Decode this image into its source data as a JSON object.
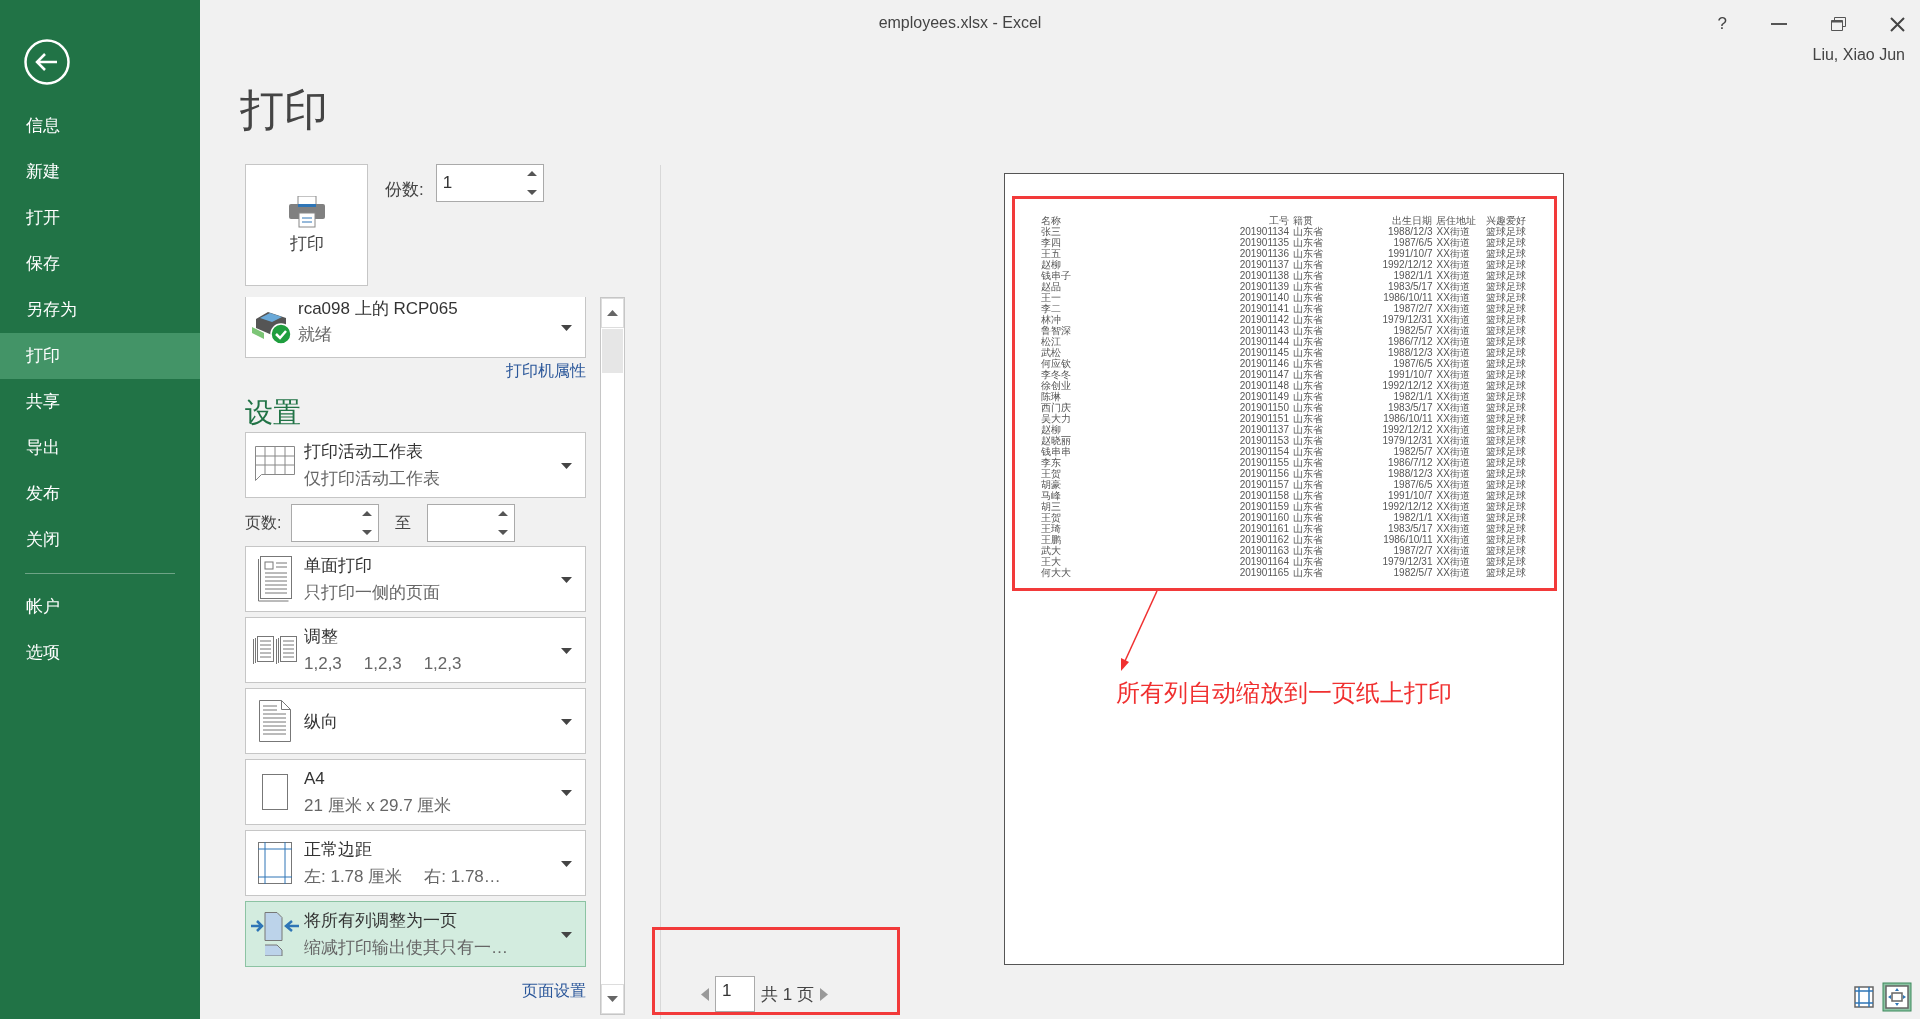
{
  "window": {
    "title": "employees.xlsx - Excel",
    "help": "?",
    "user": "Liu, Xiao Jun"
  },
  "nav": {
    "items": [
      {
        "label": "信息",
        "selected": false
      },
      {
        "label": "新建",
        "selected": false
      },
      {
        "label": "打开",
        "selected": false
      },
      {
        "label": "保存",
        "selected": false
      },
      {
        "label": "另存为",
        "selected": false
      },
      {
        "label": "打印",
        "selected": true
      },
      {
        "label": "共享",
        "selected": false
      },
      {
        "label": "导出",
        "selected": false
      },
      {
        "label": "发布",
        "selected": false
      },
      {
        "label": "关闭",
        "selected": false
      }
    ],
    "bottom_items": [
      {
        "label": "帐户",
        "selected": false
      },
      {
        "label": "选项",
        "selected": false
      }
    ]
  },
  "page_title": "打印",
  "print_button": {
    "label": "打印"
  },
  "copies": {
    "label": "份数:",
    "value": "1"
  },
  "printer": {
    "name": "rca098 上的 RCP065",
    "status": "就绪",
    "properties_link": "打印机属性"
  },
  "settings_title": "设置",
  "settings": [
    {
      "kind": "sheets",
      "title": "打印活动工作表",
      "subtitle": [
        "仅打印活动工作表"
      ],
      "selected": false
    },
    {
      "kind": "pages",
      "label": "页数:",
      "to_label": "至"
    },
    {
      "kind": "sides",
      "title": "单面打印",
      "subtitle": [
        "只打印一侧的页面"
      ],
      "selected": false
    },
    {
      "kind": "collate",
      "title": "调整",
      "subtitle": [
        "1,2,3",
        "1,2,3",
        "1,2,3"
      ],
      "selected": false
    },
    {
      "kind": "orientation",
      "title": "纵向",
      "selected": false
    },
    {
      "kind": "paper",
      "title": "A4",
      "subtitle": [
        "21 厘米 x 29.7 厘米"
      ],
      "selected": false
    },
    {
      "kind": "margins",
      "title": "正常边距",
      "subtitle": [
        "左: 1.78 厘米",
        "右: 1.78…"
      ],
      "selected": false
    },
    {
      "kind": "scaling",
      "title": "将所有列调整为一页",
      "subtitle": [
        "缩减打印输出使其只有一…"
      ],
      "selected": true
    }
  ],
  "page_setup_link": "页面设置",
  "preview": {
    "table": {
      "columns": [
        "名称",
        "工号",
        "籍贯",
        "出生日期",
        "居住地址",
        "兴趣爱好"
      ],
      "rows": [
        [
          "张三",
          "201901134",
          "山东省",
          "1988/12/3",
          "XX街道",
          "篮球足球"
        ],
        [
          "李四",
          "201901135",
          "山东省",
          "1987/6/5",
          "XX街道",
          "篮球足球"
        ],
        [
          "王五",
          "201901136",
          "山东省",
          "1991/10/7",
          "XX街道",
          "篮球足球"
        ],
        [
          "赵柳",
          "201901137",
          "山东省",
          "1992/12/12",
          "XX街道",
          "篮球足球"
        ],
        [
          "钱串子",
          "201901138",
          "山东省",
          "1982/1/1",
          "XX街道",
          "篮球足球"
        ],
        [
          "赵品",
          "201901139",
          "山东省",
          "1983/5/17",
          "XX街道",
          "篮球足球"
        ],
        [
          "王一",
          "201901140",
          "山东省",
          "1986/10/11",
          "XX街道",
          "篮球足球"
        ],
        [
          "李二",
          "201901141",
          "山东省",
          "1987/2/7",
          "XX街道",
          "篮球足球"
        ],
        [
          "林冲",
          "201901142",
          "山东省",
          "1979/12/31",
          "XX街道",
          "篮球足球"
        ],
        [
          "鲁智深",
          "201901143",
          "山东省",
          "1982/5/7",
          "XX街道",
          "篮球足球"
        ],
        [
          "松江",
          "201901144",
          "山东省",
          "1986/7/12",
          "XX街道",
          "篮球足球"
        ],
        [
          "武松",
          "201901145",
          "山东省",
          "1988/12/3",
          "XX街道",
          "篮球足球"
        ],
        [
          "何应钦",
          "201901146",
          "山东省",
          "1987/6/5",
          "XX街道",
          "篮球足球"
        ],
        [
          "李冬冬",
          "201901147",
          "山东省",
          "1991/10/7",
          "XX街道",
          "篮球足球"
        ],
        [
          "徐创业",
          "201901148",
          "山东省",
          "1992/12/12",
          "XX街道",
          "篮球足球"
        ],
        [
          "陈琳",
          "201901149",
          "山东省",
          "1982/1/1",
          "XX街道",
          "篮球足球"
        ],
        [
          "西门庆",
          "201901150",
          "山东省",
          "1983/5/17",
          "XX街道",
          "篮球足球"
        ],
        [
          "吴大力",
          "201901151",
          "山东省",
          "1986/10/11",
          "XX街道",
          "篮球足球"
        ],
        [
          "赵柳",
          "201901137",
          "山东省",
          "1992/12/12",
          "XX街道",
          "篮球足球"
        ],
        [
          "赵晓丽",
          "201901153",
          "山东省",
          "1979/12/31",
          "XX街道",
          "篮球足球"
        ],
        [
          "钱串串",
          "201901154",
          "山东省",
          "1982/5/7",
          "XX街道",
          "篮球足球"
        ],
        [
          "李东",
          "201901155",
          "山东省",
          "1986/7/12",
          "XX街道",
          "篮球足球"
        ],
        [
          "王贺",
          "201901156",
          "山东省",
          "1988/12/3",
          "XX街道",
          "篮球足球"
        ],
        [
          "胡豪",
          "201901157",
          "山东省",
          "1987/6/5",
          "XX街道",
          "篮球足球"
        ],
        [
          "马峰",
          "201901158",
          "山东省",
          "1991/10/7",
          "XX街道",
          "篮球足球"
        ],
        [
          "胡三",
          "201901159",
          "山东省",
          "1992/12/12",
          "XX街道",
          "篮球足球"
        ],
        [
          "王贺",
          "201901160",
          "山东省",
          "1982/1/1",
          "XX街道",
          "篮球足球"
        ],
        [
          "王琦",
          "201901161",
          "山东省",
          "1983/5/17",
          "XX街道",
          "篮球足球"
        ],
        [
          "王鹏",
          "201901162",
          "山东省",
          "1986/10/11",
          "XX街道",
          "篮球足球"
        ],
        [
          "武大",
          "201901163",
          "山东省",
          "1987/2/7",
          "XX街道",
          "篮球足球"
        ],
        [
          "王大",
          "201901164",
          "山东省",
          "1979/12/31",
          "XX街道",
          "篮球足球"
        ],
        [
          "何大大",
          "201901165",
          "山东省",
          "1982/5/7",
          "XX街道",
          "篮球足球"
        ]
      ]
    },
    "annotation": "所有列自动缩放到一页纸上打印"
  },
  "page_nav": {
    "current": "1",
    "total": "共 1 页"
  }
}
